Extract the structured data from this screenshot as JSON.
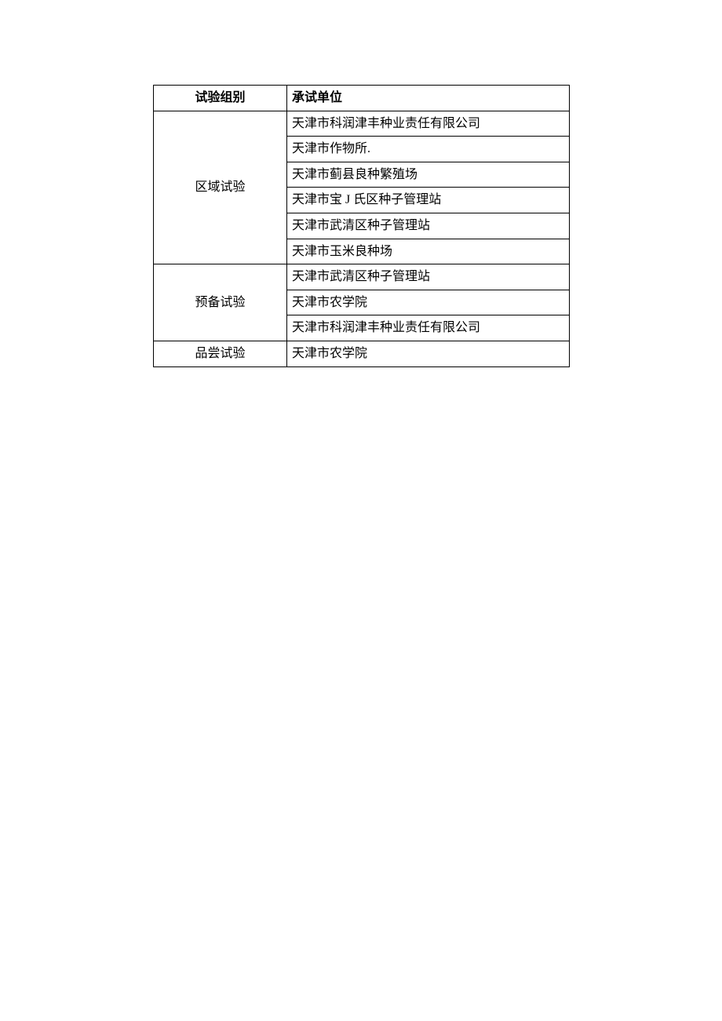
{
  "table": {
    "headers": {
      "group": "试验组别",
      "unit": "承试单位"
    },
    "groups": [
      {
        "name": "区域试验",
        "units": [
          "天津市科润津丰种业责任有限公司",
          "天津市作物所.",
          "天津市蓟县良种繁殖场",
          "天津市宝 J 氏区种子管理站",
          "天津市武清区种子管理站",
          "天津市玉米良种场"
        ]
      },
      {
        "name": "预备试验",
        "units": [
          "天津市武清区种子管理站",
          "天津市农学院",
          "天津市科润津丰种业责任有限公司"
        ]
      },
      {
        "name": "品尝试验",
        "units": [
          "天津市农学院"
        ]
      }
    ]
  }
}
